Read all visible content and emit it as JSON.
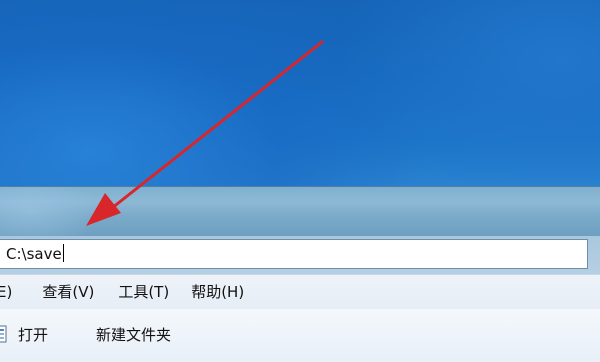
{
  "address_bar": {
    "value": "C:\\save"
  },
  "menu": {
    "items": [
      "E)",
      "查看(V)",
      "工具(T)",
      "帮助(H)"
    ]
  },
  "toolbar": {
    "open_label": "打开",
    "new_folder_label": "新建文件夹"
  },
  "colors": {
    "annotation_arrow": "#d9262b"
  }
}
